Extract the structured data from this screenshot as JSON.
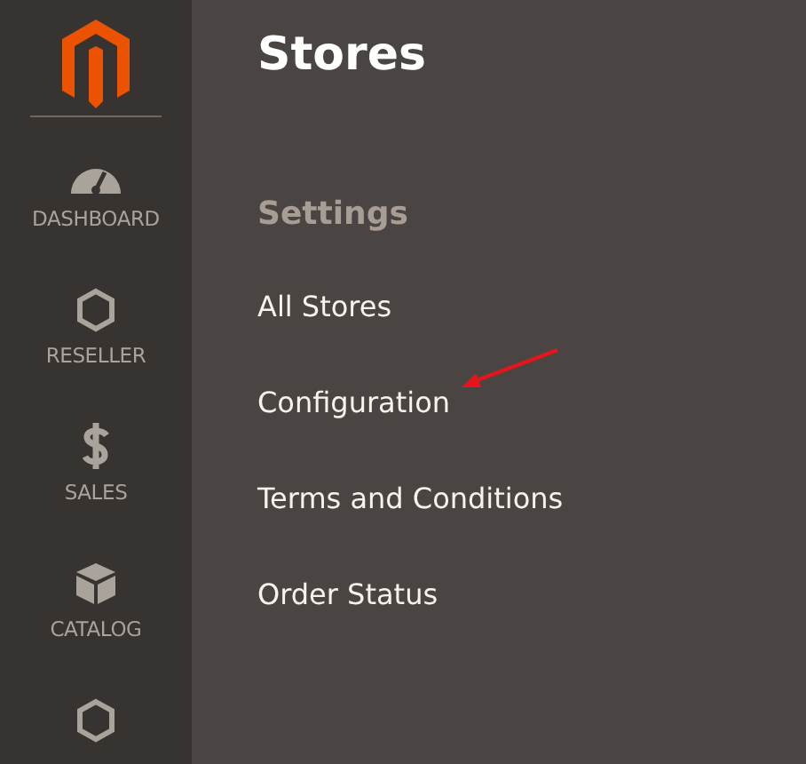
{
  "sidebar": {
    "items": [
      {
        "kind": "gauge",
        "label": "DASHBOARD"
      },
      {
        "kind": "hexagon",
        "label": "RESELLER"
      },
      {
        "kind": "dollar",
        "label": "SALES"
      },
      {
        "kind": "box",
        "label": "CATALOG"
      },
      {
        "kind": "hexagon"
      }
    ]
  },
  "panel": {
    "title": "Stores",
    "section": "Settings",
    "links": [
      "All Stores",
      "Configuration",
      "Terms and Conditions",
      "Order Status"
    ]
  }
}
